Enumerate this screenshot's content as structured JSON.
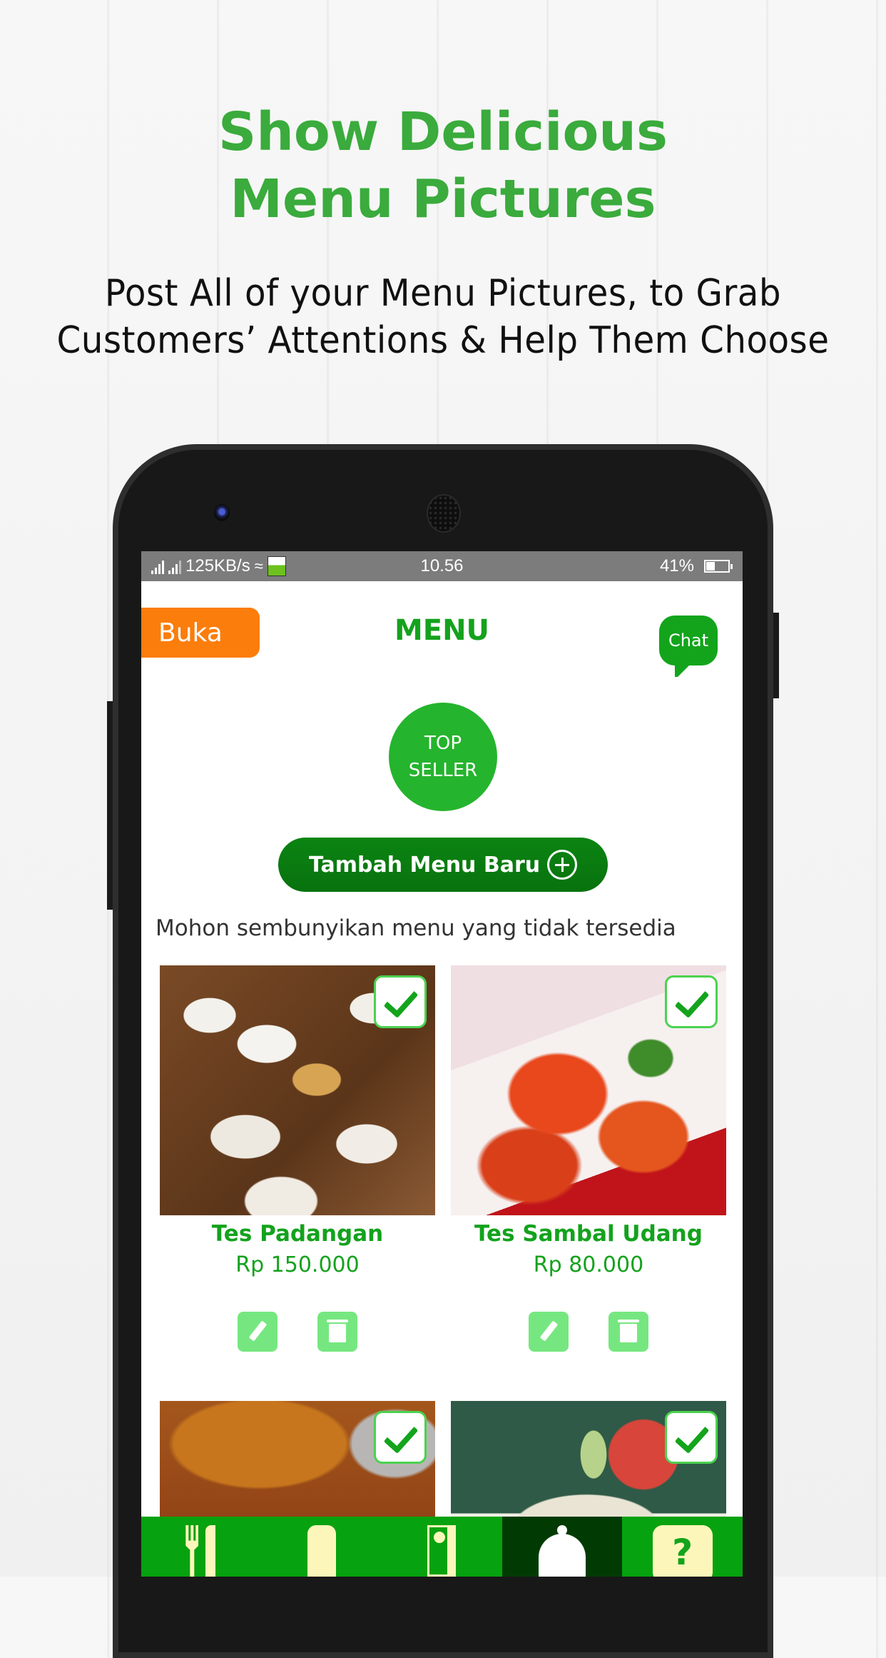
{
  "promo": {
    "headline_line1": "Show Delicious",
    "headline_line2": "Menu Pictures",
    "subline_line1": "Post All of your Menu Pictures, to Grab",
    "subline_line2": "Customers’ Attentions & Help Them Choose"
  },
  "status_bar": {
    "network_speed": "125KB/s",
    "time": "10.56",
    "battery_percent": "41%",
    "battery_level": 0.41,
    "icons": [
      "signal-icon",
      "signal-icon",
      "wifi-icon",
      "app-notification-icon",
      "battery-icon"
    ]
  },
  "header": {
    "status_button": "Buka",
    "title": "MENU",
    "chat_button": "Chat"
  },
  "top_seller": {
    "line1": "TOP",
    "line2": "SELLER"
  },
  "add_menu_button": {
    "label": "Tambah Menu Baru",
    "icon": "plus-circle-icon"
  },
  "hint_text": "Mohon sembunyikan menu yang tidak tersedia",
  "menu_items": [
    {
      "name": "Tes Padangan",
      "price": "Rp 150.000",
      "visible": true
    },
    {
      "name": "Tes Sambal Udang",
      "price": "Rp 80.000",
      "visible": true
    },
    {
      "name": "",
      "price": "",
      "visible": true
    },
    {
      "name": "",
      "price": "",
      "visible": true
    }
  ],
  "bottom_nav": {
    "items": [
      {
        "icon": "fork-knife-icon",
        "active": false
      },
      {
        "icon": "chef-hat-icon",
        "active": false
      },
      {
        "icon": "report-document-icon",
        "active": false
      },
      {
        "icon": "cloche-icon",
        "active": true
      },
      {
        "icon": "help-icon",
        "label": "?",
        "active": false
      }
    ]
  },
  "colors": {
    "brand_green": "#14a21d",
    "headline_green": "#3aab3c",
    "buka_orange": "#fb7d0c",
    "dark_green_button": "#08720e",
    "nav_green": "#06a20f",
    "nav_active": "#013b03",
    "action_green": "#76e780",
    "nav_icon_cream": "#fdf6ba"
  }
}
